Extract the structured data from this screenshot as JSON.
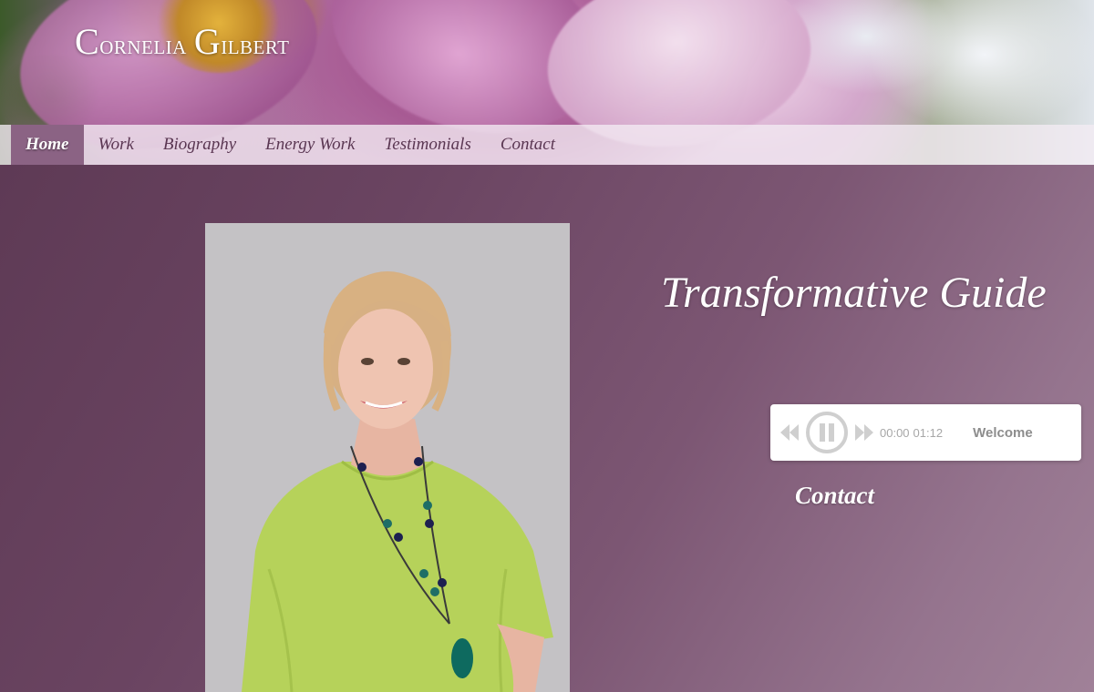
{
  "site": {
    "title_first_cap": "C",
    "title_first_rest": "ornelia",
    "title_last_cap": "G",
    "title_last_rest": "ilbert"
  },
  "nav": {
    "items": [
      {
        "label": "Home",
        "active": true
      },
      {
        "label": "Work"
      },
      {
        "label": "Biography"
      },
      {
        "label": "Energy Work"
      },
      {
        "label": "Testimonials"
      },
      {
        "label": "Contact"
      }
    ]
  },
  "main": {
    "tagline": "Transformative Guide",
    "contact_link": "Contact"
  },
  "player": {
    "current_time": "00:00",
    "duration": "01:12",
    "track_title": "Welcome",
    "state": "playing"
  },
  "colors": {
    "main_bg": "#6e4762",
    "nav_active_bg": "#8b6384",
    "nav_text": "#5a3652"
  }
}
